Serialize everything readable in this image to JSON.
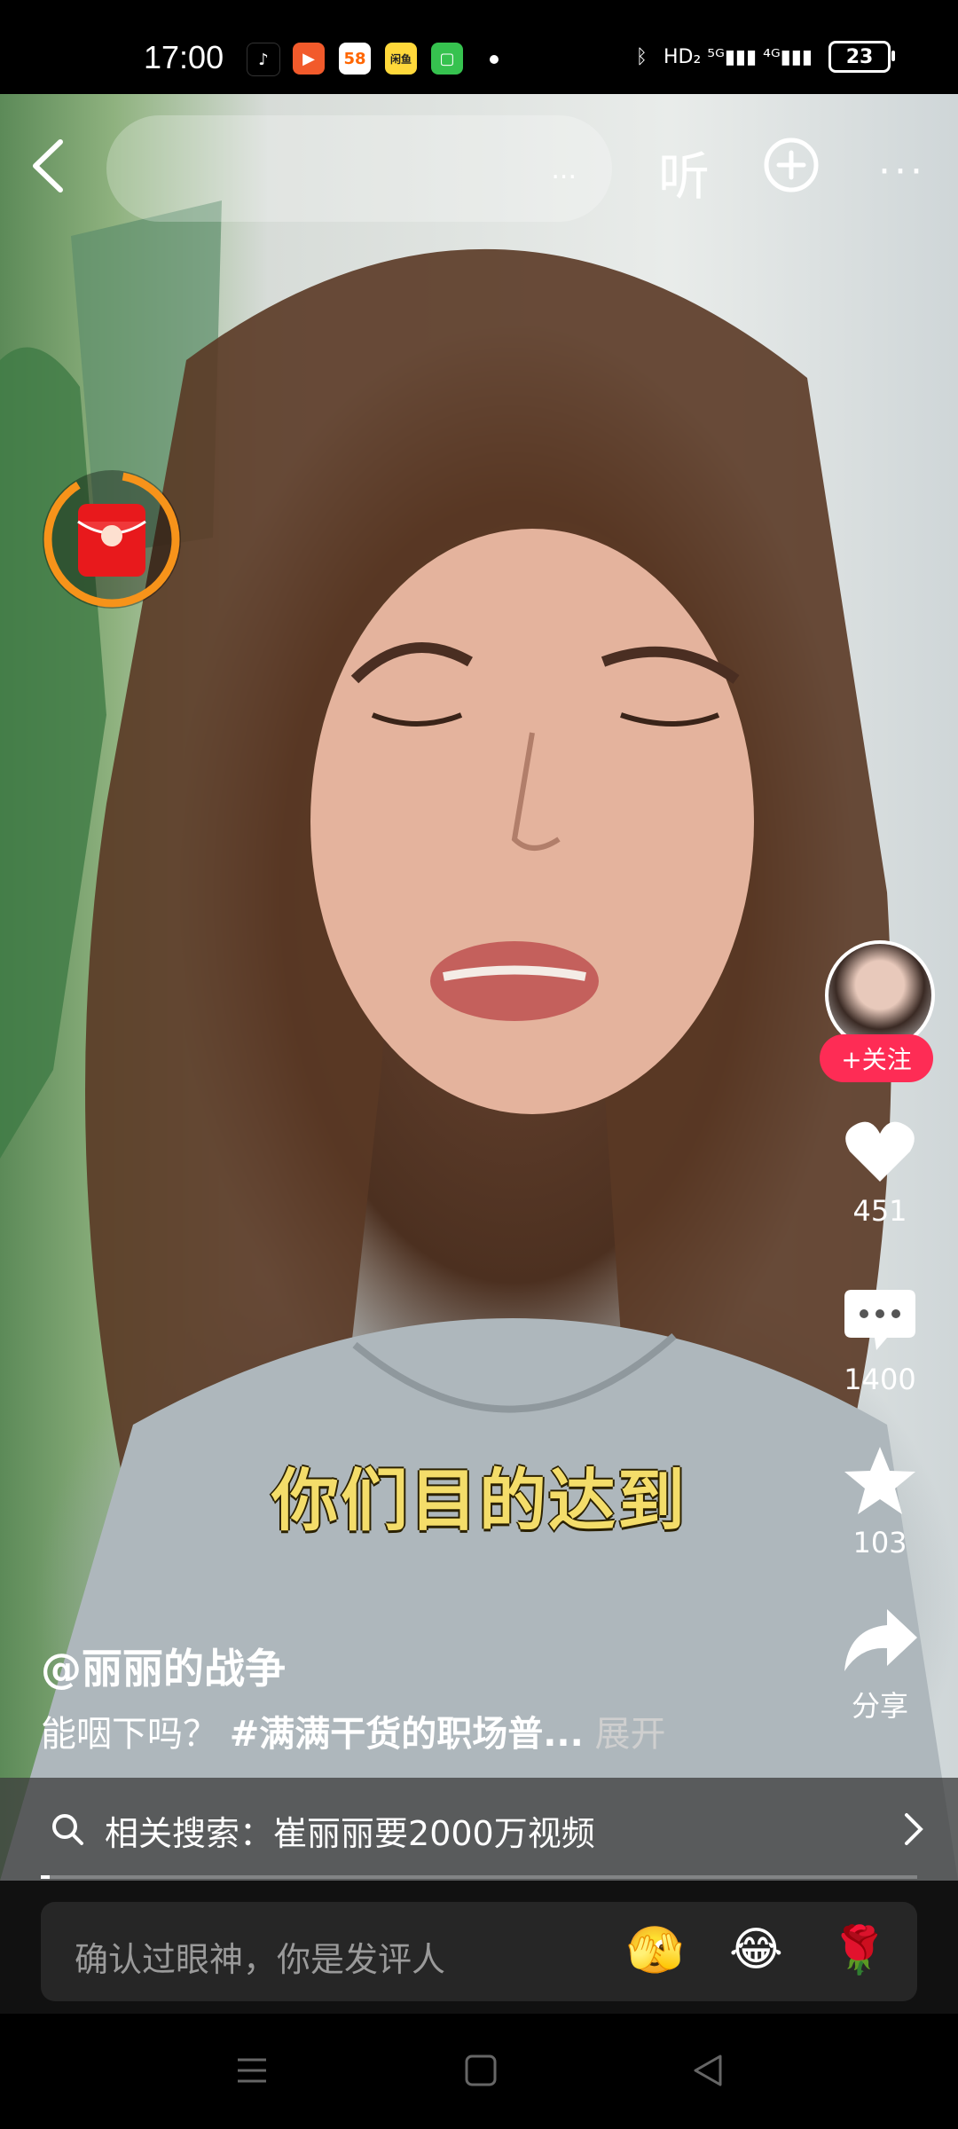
{
  "status_bar": {
    "time": "17:00",
    "apps": [
      {
        "name": "tiktok-app-icon",
        "glyph": "♪",
        "bg": "#000000",
        "fg": "#ffffff"
      },
      {
        "name": "video-app-icon",
        "glyph": "▶",
        "bg": "#f25a2b",
        "fg": "#ffffff"
      },
      {
        "name": "58-app-icon",
        "glyph": "58",
        "bg": "#ffffff",
        "fg": "#ff6600"
      },
      {
        "name": "xianyu-app-icon",
        "glyph": "闲鱼",
        "bg": "#ffd83a",
        "fg": "#222222"
      },
      {
        "name": "messages-app-icon",
        "glyph": "▢",
        "bg": "#36c24f",
        "fg": "#ffffff"
      }
    ],
    "network": "HD₂  ⁵ᴳ▮▮▮  ⁴ᴳ▮▮▮",
    "battery": "23"
  },
  "top_bar": {
    "search_hint": "...",
    "listen_label": "听"
  },
  "creator": {
    "follow_label": "+关注"
  },
  "actions": {
    "likes": "451",
    "comments": "1400",
    "favorites": "103",
    "share_label": "分享"
  },
  "subtitle": "你们目的达到",
  "post": {
    "author": "@丽丽的战争",
    "description": "能咽下吗？",
    "hashtag": "#满满干货的职场普...",
    "expand_label": "展开"
  },
  "related_search": {
    "label": "相关搜索：",
    "query": "崔丽丽要2000万视频"
  },
  "playback": {
    "progress": 0.01
  },
  "comment": {
    "placeholder": "确认过眼神，你是发评人"
  },
  "emojis": [
    "🫣",
    "😂",
    "🌹"
  ],
  "colors": {
    "accent": "#fe2c55",
    "subtitle": "#f4dd6a",
    "redpacket_ring": "#f7931a"
  }
}
